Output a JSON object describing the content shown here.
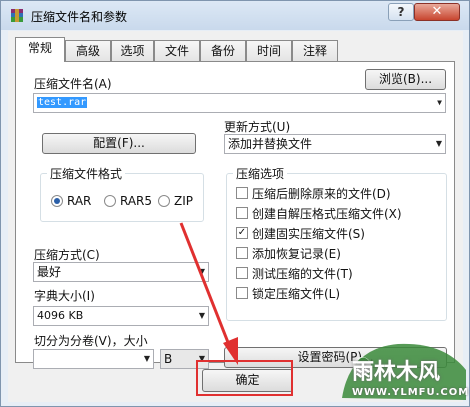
{
  "window": {
    "title": "压缩文件名和参数",
    "help": "?",
    "close": "✕"
  },
  "tabs": [
    "常规",
    "高级",
    "选项",
    "文件",
    "备份",
    "时间",
    "注释"
  ],
  "archive_name": {
    "label": "压缩文件名(A)",
    "browse": "浏览(B)...",
    "value": "test.rar"
  },
  "update_mode": {
    "label": "更新方式(U)",
    "value": "添加并替换文件"
  },
  "profiles_button": "配置(F)...",
  "format": {
    "title": "压缩文件格式",
    "options": [
      "RAR",
      "RAR5",
      "ZIP"
    ],
    "selected": "RAR"
  },
  "compression": {
    "label": "压缩方式(C)",
    "value": "最好"
  },
  "dictionary": {
    "label": "字典大小(I)",
    "value": "4096 KB"
  },
  "split": {
    "label": "切分为分卷(V)，大小",
    "value": "",
    "unit": "B"
  },
  "options": {
    "title": "压缩选项",
    "items": [
      {
        "label": "压缩后删除原来的文件(D)",
        "checked": false
      },
      {
        "label": "创建自解压格式压缩文件(X)",
        "checked": false
      },
      {
        "label": "创建固实压缩文件(S)",
        "checked": true
      },
      {
        "label": "添加恢复记录(E)",
        "checked": false
      },
      {
        "label": "测试压缩的文件(T)",
        "checked": false
      },
      {
        "label": "锁定压缩文件(L)",
        "checked": false
      }
    ]
  },
  "password_button": "设置密码(P)...",
  "ok_button": "确定",
  "watermark": {
    "text": "雨林木风",
    "url": "WWW.YLMFU.COM"
  },
  "colors": {
    "annotation": "#e03030",
    "watermark": "#3a8a3a"
  }
}
